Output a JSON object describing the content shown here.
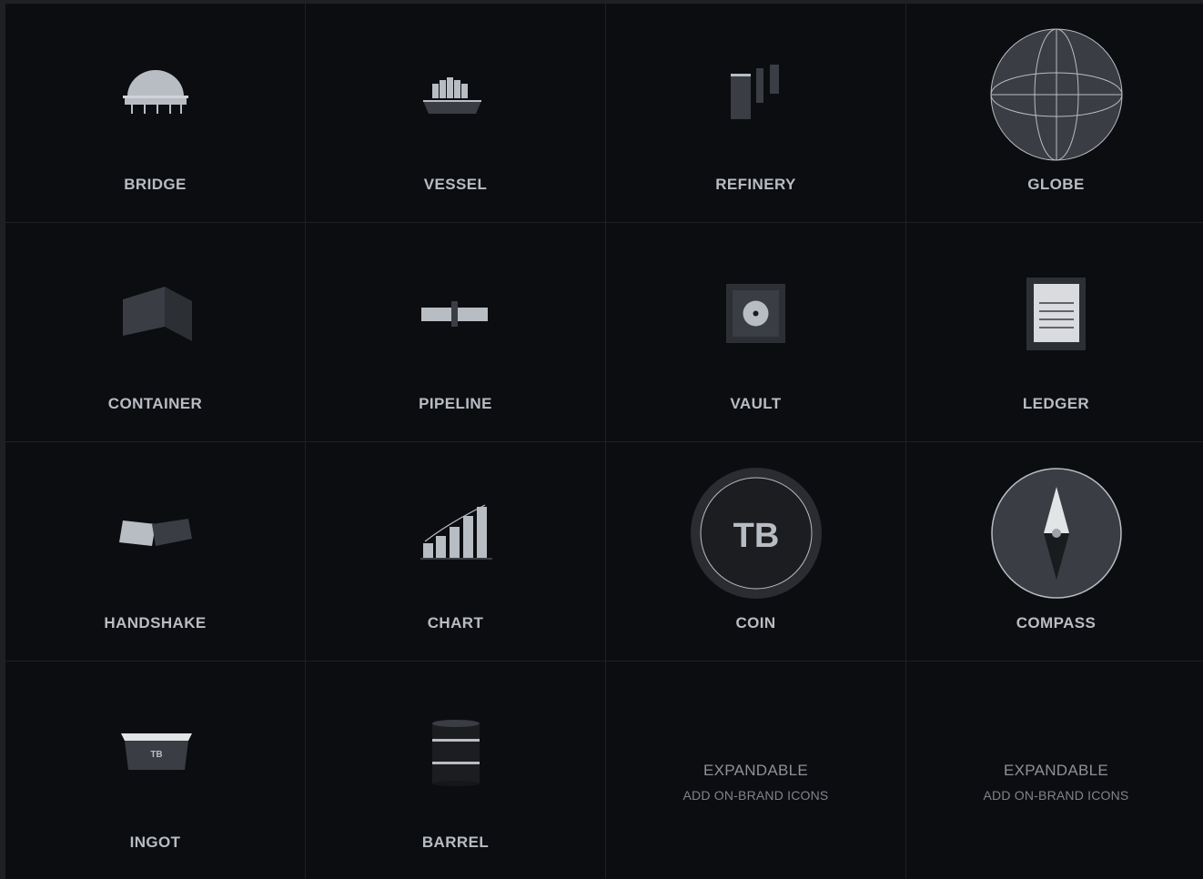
{
  "icons": [
    {
      "label": "BRIDGE",
      "icon": "bridge-icon"
    },
    {
      "label": "VESSEL",
      "icon": "vessel-icon"
    },
    {
      "label": "REFINERY",
      "icon": "refinery-icon"
    },
    {
      "label": "GLOBE",
      "icon": "globe-icon"
    },
    {
      "label": "CONTAINER",
      "icon": "container-icon"
    },
    {
      "label": "PIPELINE",
      "icon": "pipeline-icon"
    },
    {
      "label": "VAULT",
      "icon": "vault-icon"
    },
    {
      "label": "LEDGER",
      "icon": "ledger-icon"
    },
    {
      "label": "HANDSHAKE",
      "icon": "handshake-icon"
    },
    {
      "label": "CHART",
      "icon": "chart-icon"
    },
    {
      "label": "COIN",
      "icon": "coin-icon",
      "monogram": "TB"
    },
    {
      "label": "COMPASS",
      "icon": "compass-icon"
    },
    {
      "label": "INGOT",
      "icon": "ingot-icon",
      "stamp": "TB"
    },
    {
      "label": "BARREL",
      "icon": "barrel-icon"
    }
  ],
  "placeholders": [
    {
      "title": "EXPANDABLE",
      "subtitle": "ADD ON-BRAND ICONS"
    },
    {
      "title": "EXPANDABLE",
      "subtitle": "ADD ON-BRAND ICONS"
    }
  ],
  "colors": {
    "background": "#0c0d10",
    "grid_line": "#1f2024",
    "icon_light": "#b8bcc3",
    "icon_dark": "#3a3d43",
    "label": "#b8bcc3"
  }
}
